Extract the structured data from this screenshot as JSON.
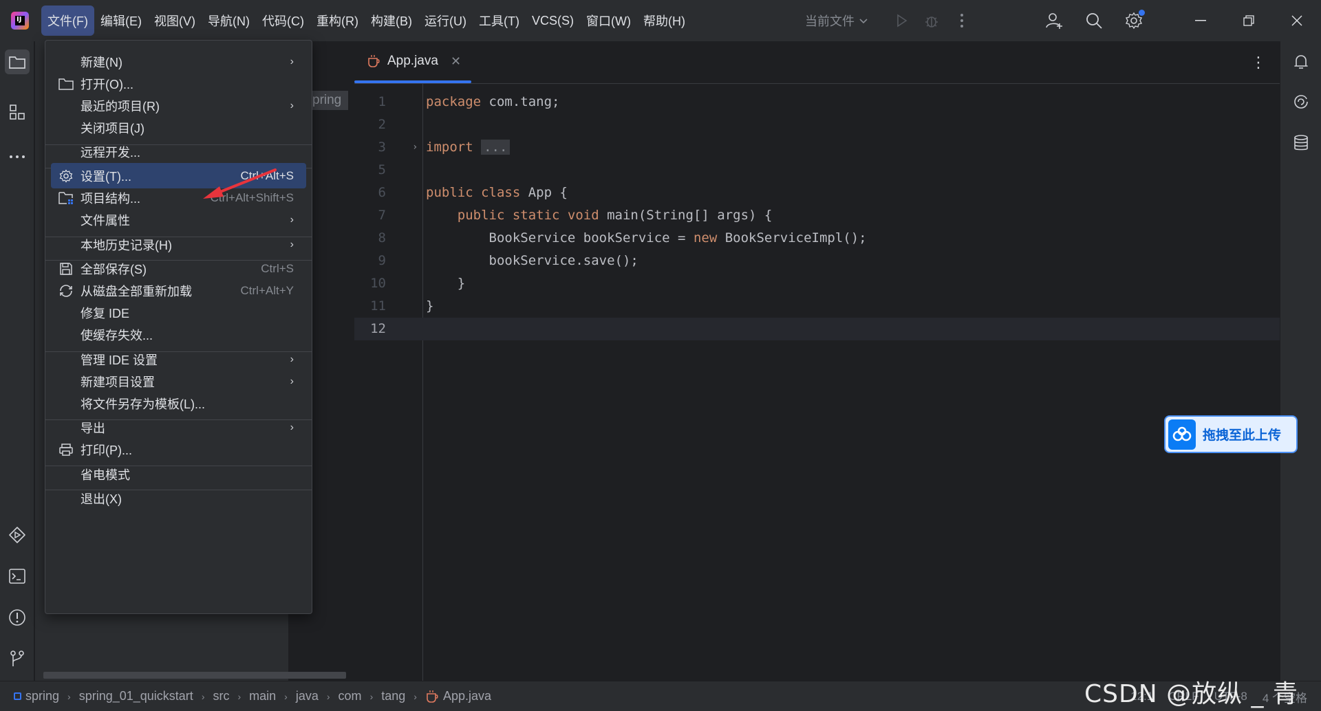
{
  "menubar": {
    "items": [
      "文件(F)",
      "编辑(E)",
      "视图(V)",
      "导航(N)",
      "代码(C)",
      "重构(R)",
      "构建(B)",
      "运行(U)",
      "工具(T)",
      "VCS(S)",
      "窗口(W)",
      "帮助(H)"
    ],
    "active_index": 0
  },
  "toolbar": {
    "run_config": "当前文件"
  },
  "project_panel": {
    "visible_snippet": "pring"
  },
  "file_menu": {
    "new": "新建(N)",
    "open": "打开(O)...",
    "recent": "最近的项目(R)",
    "close_project": "关闭项目(J)",
    "remote_dev": "远程开发...",
    "settings": "设置(T)...",
    "settings_shortcut": "Ctrl+Alt+S",
    "project_structure": "项目结构...",
    "project_structure_shortcut": "Ctrl+Alt+Shift+S",
    "file_properties": "文件属性",
    "local_history": "本地历史记录(H)",
    "save_all": "全部保存(S)",
    "save_all_shortcut": "Ctrl+S",
    "reload_all": "从磁盘全部重新加载",
    "reload_all_shortcut": "Ctrl+Alt+Y",
    "repair_ide": "修复 IDE",
    "invalidate_caches": "使缓存失效...",
    "manage_ide_settings": "管理 IDE 设置",
    "new_project_settings": "新建项目设置",
    "save_as_template": "将文件另存为模板(L)...",
    "export": "导出",
    "print": "打印(P)...",
    "power_save": "省电模式",
    "exit": "退出(X)"
  },
  "editor": {
    "tab_label": "App.java",
    "lines": [
      {
        "n": "1",
        "parts": [
          {
            "t": "package",
            "k": "kw"
          },
          {
            "t": " com.tang;",
            "k": ""
          }
        ]
      },
      {
        "n": "2",
        "parts": []
      },
      {
        "n": "3",
        "parts": [
          {
            "t": "import",
            "k": "kw"
          },
          {
            "t": " ",
            "k": ""
          },
          {
            "t": "...",
            "k": "folded"
          }
        ],
        "fold": true
      },
      {
        "n": "5",
        "parts": []
      },
      {
        "n": "6",
        "parts": [
          {
            "t": "public class",
            "k": "kw"
          },
          {
            "t": " App {",
            "k": ""
          }
        ]
      },
      {
        "n": "7",
        "parts": [
          {
            "t": "    ",
            "k": ""
          },
          {
            "t": "public static void",
            "k": "kw"
          },
          {
            "t": " main(String[] args) {",
            "k": ""
          }
        ]
      },
      {
        "n": "8",
        "parts": [
          {
            "t": "        BookService bookService = ",
            "k": ""
          },
          {
            "t": "new",
            "k": "kw"
          },
          {
            "t": " BookServiceImpl();",
            "k": ""
          }
        ]
      },
      {
        "n": "9",
        "parts": [
          {
            "t": "        bookService.save();",
            "k": ""
          }
        ]
      },
      {
        "n": "10",
        "parts": [
          {
            "t": "    }",
            "k": ""
          }
        ]
      },
      {
        "n": "11",
        "parts": [
          {
            "t": "}",
            "k": ""
          }
        ]
      },
      {
        "n": "12",
        "parts": [],
        "current": true
      }
    ]
  },
  "upload": {
    "label": "拖拽至此上传"
  },
  "statusbar": {
    "breadcrumbs": [
      "spring",
      "spring_01_quickstart",
      "src",
      "main",
      "java",
      "com",
      "tang",
      "App.java"
    ],
    "position": "12:1",
    "line_sep": "CRLF",
    "encoding": "UTF-8",
    "indent": "4 个空格"
  },
  "watermark": "CSDN @放纵 _ 青春",
  "colors": {
    "menu_highlight": "#2e436e",
    "menubar_active": "#3d4f84",
    "keyword": "#cf8e6d",
    "arrow_red": "#e8343c"
  }
}
